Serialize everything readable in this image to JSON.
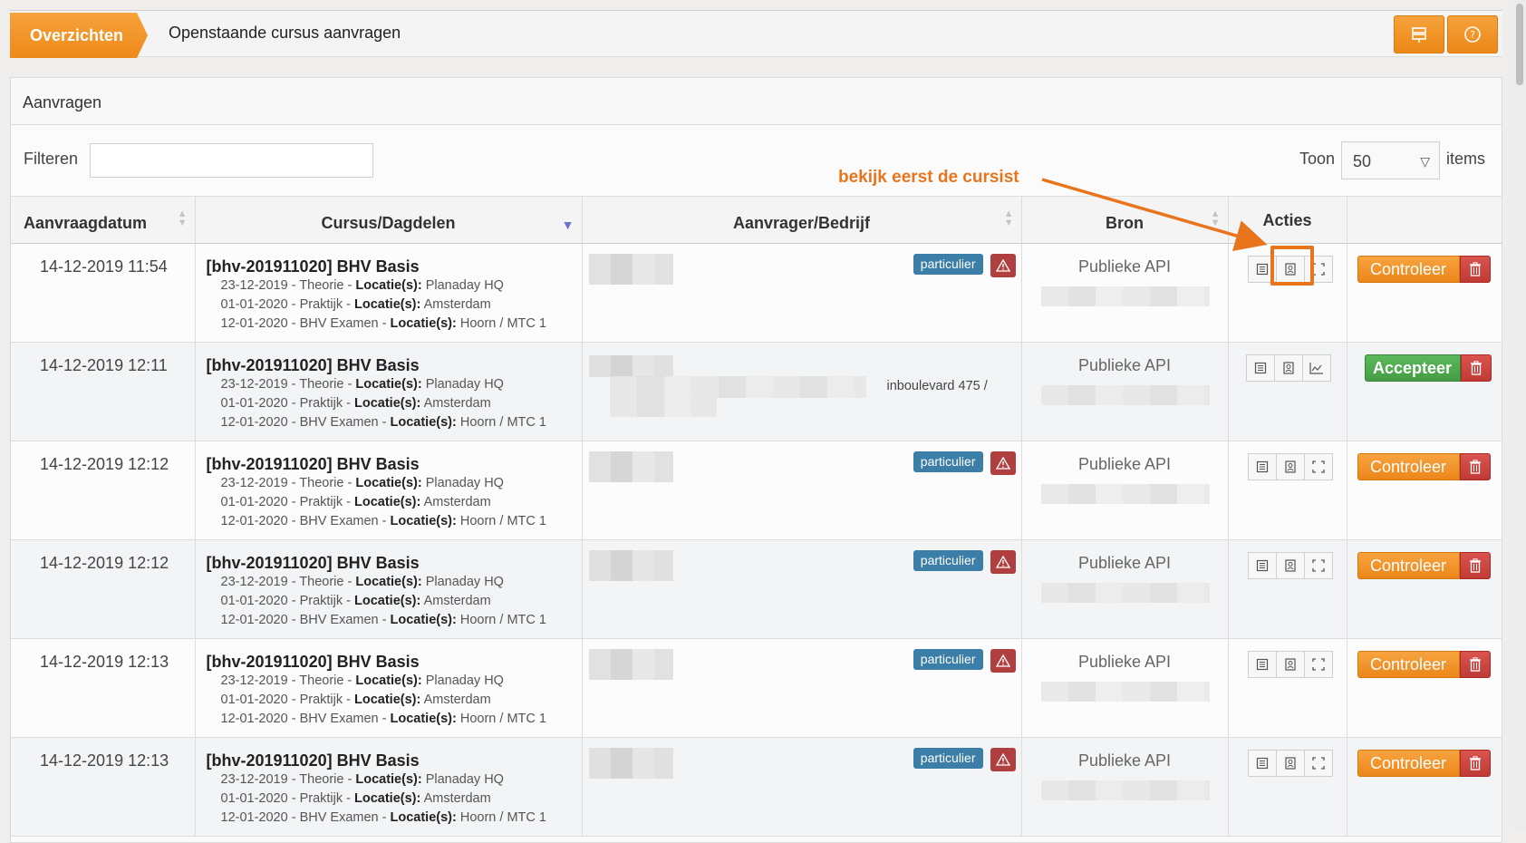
{
  "breadcrumb": {
    "section": "Overzichten",
    "current": "Openstaande cursus aanvragen"
  },
  "toolbar": {
    "icons": [
      "signpost-icon",
      "help-icon"
    ]
  },
  "panel": {
    "title": "Aanvragen",
    "filter_label": "Filteren",
    "filter_value": "",
    "show_label": "Toon",
    "show_value": "50",
    "items_label": "items"
  },
  "table": {
    "headers": [
      "Aanvraagdatum",
      "Cursus/Dagdelen",
      "Aanvrager/Bedrijf",
      "Bron",
      "Acties",
      ""
    ],
    "sorted_column": "Cursus/Dagdelen",
    "rows": [
      {
        "date": "14-12-2019 11:54",
        "course": "[bhv-201911020] BHV Basis",
        "sessions": [
          {
            "date": "23-12-2019",
            "type": "Theorie",
            "loc_label": "Locatie(s):",
            "loc": "Planaday HQ"
          },
          {
            "date": "01-01-2020",
            "type": "Praktijk",
            "loc_label": "Locatie(s):",
            "loc": "Amsterdam"
          },
          {
            "date": "12-01-2020",
            "type": "BHV Examen",
            "loc_label": "Locatie(s):",
            "loc": "Hoorn / MTC 1"
          }
        ],
        "badge": "particulier",
        "address": "",
        "source": "Publieke API",
        "action": "Controleer",
        "third_icon": "fullscreen-icon"
      },
      {
        "date": "14-12-2019 12:11",
        "course": "[bhv-201911020] BHV Basis",
        "sessions": [
          {
            "date": "23-12-2019",
            "type": "Theorie",
            "loc_label": "Locatie(s):",
            "loc": "Planaday HQ"
          },
          {
            "date": "01-01-2020",
            "type": "Praktijk",
            "loc_label": "Locatie(s):",
            "loc": "Amsterdam"
          },
          {
            "date": "12-01-2020",
            "type": "BHV Examen",
            "loc_label": "Locatie(s):",
            "loc": "Hoorn / MTC 1"
          }
        ],
        "badge": "",
        "address": "inboulevard 475 /",
        "source": "Publieke API",
        "action": "Accepteer",
        "third_icon": "chart-icon"
      },
      {
        "date": "14-12-2019 12:12",
        "course": "[bhv-201911020] BHV Basis",
        "sessions": [
          {
            "date": "23-12-2019",
            "type": "Theorie",
            "loc_label": "Locatie(s):",
            "loc": "Planaday HQ"
          },
          {
            "date": "01-01-2020",
            "type": "Praktijk",
            "loc_label": "Locatie(s):",
            "loc": "Amsterdam"
          },
          {
            "date": "12-01-2020",
            "type": "BHV Examen",
            "loc_label": "Locatie(s):",
            "loc": "Hoorn / MTC 1"
          }
        ],
        "badge": "particulier",
        "address": "",
        "source": "Publieke API",
        "action": "Controleer",
        "third_icon": "fullscreen-icon"
      },
      {
        "date": "14-12-2019 12:12",
        "course": "[bhv-201911020] BHV Basis",
        "sessions": [
          {
            "date": "23-12-2019",
            "type": "Theorie",
            "loc_label": "Locatie(s):",
            "loc": "Planaday HQ"
          },
          {
            "date": "01-01-2020",
            "type": "Praktijk",
            "loc_label": "Locatie(s):",
            "loc": "Amsterdam"
          },
          {
            "date": "12-01-2020",
            "type": "BHV Examen",
            "loc_label": "Locatie(s):",
            "loc": "Hoorn / MTC 1"
          }
        ],
        "badge": "particulier",
        "address": "",
        "source": "Publieke API",
        "action": "Controleer",
        "third_icon": "fullscreen-icon"
      },
      {
        "date": "14-12-2019 12:13",
        "course": "[bhv-201911020] BHV Basis",
        "sessions": [
          {
            "date": "23-12-2019",
            "type": "Theorie",
            "loc_label": "Locatie(s):",
            "loc": "Planaday HQ"
          },
          {
            "date": "01-01-2020",
            "type": "Praktijk",
            "loc_label": "Locatie(s):",
            "loc": "Amsterdam"
          },
          {
            "date": "12-01-2020",
            "type": "BHV Examen",
            "loc_label": "Locatie(s):",
            "loc": "Hoorn / MTC 1"
          }
        ],
        "badge": "particulier",
        "address": "",
        "source": "Publieke API",
        "action": "Controleer",
        "third_icon": "fullscreen-icon"
      },
      {
        "date": "14-12-2019 12:13",
        "course": "[bhv-201911020] BHV Basis",
        "sessions": [
          {
            "date": "23-12-2019",
            "type": "Theorie",
            "loc_label": "Locatie(s):",
            "loc": "Planaday HQ"
          },
          {
            "date": "01-01-2020",
            "type": "Praktijk",
            "loc_label": "Locatie(s):",
            "loc": "Amsterdam"
          },
          {
            "date": "12-01-2020",
            "type": "BHV Examen",
            "loc_label": "Locatie(s):",
            "loc": "Hoorn / MTC 1"
          }
        ],
        "badge": "particulier",
        "address": "",
        "source": "Publieke API",
        "action": "Controleer",
        "third_icon": "fullscreen-icon"
      }
    ]
  },
  "annotation": {
    "text": "bekijk eerst de cursist"
  },
  "colors": {
    "accent": "#ee8a1a",
    "badge": "#3b7ea8",
    "danger": "#c03a36",
    "success": "#449d44",
    "annotation": "#e8741c"
  }
}
